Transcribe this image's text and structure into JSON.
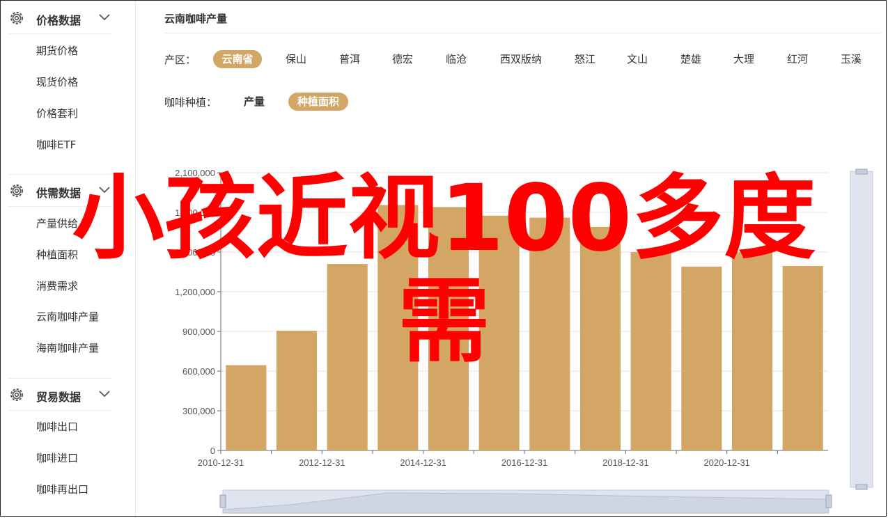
{
  "sidebar": {
    "sections": [
      {
        "title": "价格数据",
        "items": [
          "期货价格",
          "现货价格",
          "价格套利",
          "咖啡ETF"
        ]
      },
      {
        "title": "供需数据",
        "items": [
          "产量供给",
          "种植面积",
          "消费需求",
          "云南咖啡产量",
          "海南咖啡产量"
        ]
      },
      {
        "title": "贸易数据",
        "items": [
          "咖啡出口",
          "咖啡进口",
          "咖啡再出口"
        ]
      }
    ],
    "icon": "gear-icon",
    "expand_icon": "chevron-down-icon"
  },
  "main": {
    "title": "云南咖啡产量",
    "region_label": "产区：",
    "regions": [
      "云南省",
      "保山",
      "普洱",
      "德宏",
      "临沧",
      "西双版纳",
      "怒江",
      "文山",
      "楚雄",
      "大理",
      "红河",
      "玉溪"
    ],
    "region_selected": "云南省",
    "type_label": "咖啡种植：",
    "types": [
      "产量",
      "种植面积"
    ],
    "type_selected": "种植面积"
  },
  "overlay": {
    "line1": "小孩近视100多度",
    "line2": "需"
  },
  "colors": {
    "accent": "#d4a666",
    "bar": "#d4a666",
    "overlay": "#ff0000"
  },
  "chart_data": {
    "type": "bar",
    "x": [
      "2010-12-31",
      "2011-12-31",
      "2012-12-31",
      "2013-12-31",
      "2014-12-31",
      "2015-12-31",
      "2016-12-31",
      "2017-12-31",
      "2018-12-31",
      "2019-12-31",
      "2020-12-31",
      "2021-12-31"
    ],
    "xticks": [
      "2010-12-31",
      "2012-12-31",
      "2014-12-31",
      "2016-12-31",
      "2018-12-31",
      "2020-12-31"
    ],
    "values": [
      645000,
      905000,
      1410000,
      1855000,
      1840000,
      1775000,
      1760000,
      1690000,
      1500000,
      1390000,
      1500000,
      1395000
    ],
    "ylim": [
      0,
      2100000
    ],
    "yticks": [
      0,
      300000,
      600000,
      900000,
      1200000,
      1500000,
      1800000,
      2100000
    ],
    "ytick_labels": [
      "0",
      "300,000",
      "600,000",
      "900,000",
      "1,200,000",
      "1,500,000",
      "1,800,000",
      "2,100,000"
    ],
    "grid": true
  }
}
